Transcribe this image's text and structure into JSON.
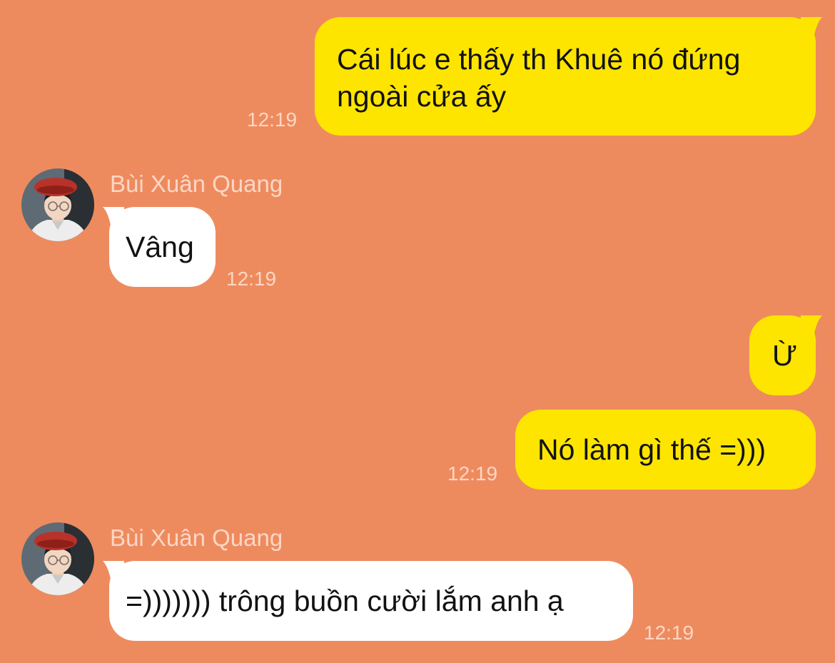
{
  "theme": {
    "background": "#EE8B5E",
    "outgoing_bubble": "#FEE500",
    "incoming_bubble": "#FFFFFF",
    "meta_text": "#FBD6C5",
    "message_text": "#121212"
  },
  "messages": [
    {
      "direction": "outgoing",
      "text": "Cái lúc e thấy th Khuê nó đứng\nngoài cửa ấy",
      "time": "12:19"
    },
    {
      "direction": "incoming",
      "sender": "Bùi Xuân Quang",
      "avatar_icon": "profile-photo",
      "text": "Vâng",
      "time": "12:19"
    },
    {
      "direction": "outgoing",
      "text": "Ừ"
    },
    {
      "direction": "outgoing",
      "text": "Nó làm gì thế =)))",
      "time": "12:19"
    },
    {
      "direction": "incoming",
      "sender": "Bùi Xuân Quang",
      "avatar_icon": "profile-photo",
      "text": "=))))))) trông buồn cười lắm anh ạ",
      "time": "12:19"
    }
  ]
}
